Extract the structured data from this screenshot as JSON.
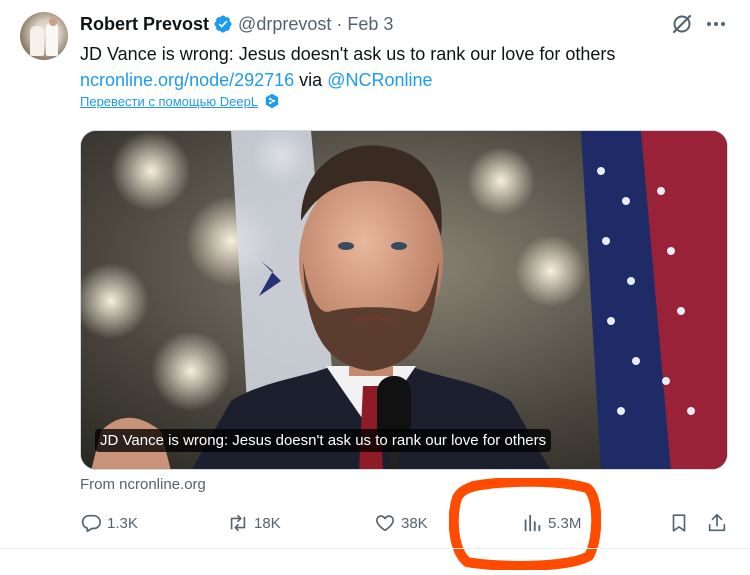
{
  "author": {
    "name": "Robert Prevost",
    "handle": "@drprevost",
    "separator": "·",
    "date": "Feb 3"
  },
  "tweet": {
    "text": "JD Vance is wrong: Jesus doesn't ask us to rank our love for others",
    "link": "ncronline.org/node/292716",
    "via_text": " via ",
    "mention": "@NCRonline"
  },
  "translate_label": "Перевести с помощью DeepL",
  "card": {
    "caption": "JD Vance is wrong: Jesus doesn't ask us to rank our love for others",
    "source": "From ncronline.org"
  },
  "actions": {
    "replies": "1.3K",
    "reposts": "18K",
    "likes": "38K",
    "views": "5.3M"
  },
  "icons": [
    "verified-badge-icon",
    "grok-icon",
    "more-icon",
    "deepl-icon",
    "reply-icon",
    "repost-icon",
    "like-icon",
    "views-icon",
    "bookmark-icon",
    "share-icon"
  ],
  "colors": {
    "accent": "#1d9bf0",
    "muted": "#536471",
    "text": "#0f1419",
    "annotation": "#ff4b00"
  }
}
